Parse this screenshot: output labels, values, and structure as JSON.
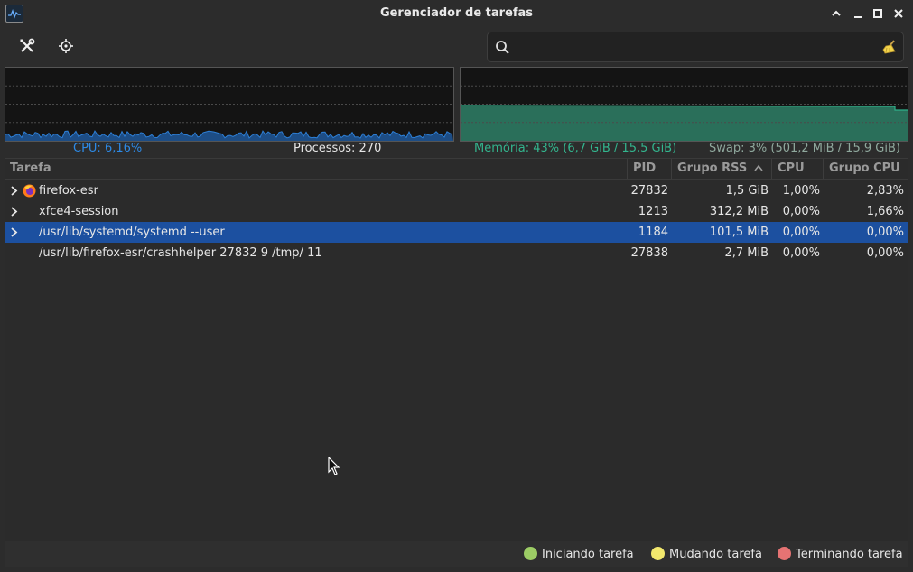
{
  "window": {
    "title": "Gerenciador de tarefas"
  },
  "toolbar": {
    "settings_icon": "tools-icon",
    "target_icon": "crosshair-icon"
  },
  "search": {
    "value": "",
    "placeholder": ""
  },
  "stats": {
    "cpu": "CPU: 6,16%",
    "processes": "Processos: 270",
    "memory": "Memória: 43% (6,7 GiB / 15,5 GiB)",
    "swap": "Swap: 3% (501,2 MiB / 15,9 GiB)"
  },
  "graphs": {
    "cpu_color": "#2d7fd6",
    "mem_color": "#2fb08a",
    "memory_percent": 43
  },
  "table": {
    "columns": [
      "Tarefa",
      "PID",
      "Grupo RSS",
      "CPU",
      "Grupo CPU"
    ],
    "sort_column": "Grupo RSS",
    "rows": [
      {
        "task": "firefox-esr",
        "pid": "27832",
        "rss": "1,5 GiB",
        "cpu": "1,00%",
        "group_cpu": "2,83%",
        "expandable": true,
        "icon": "firefox-icon"
      },
      {
        "task": "xfce4-session",
        "pid": "1213",
        "rss": "312,2 MiB",
        "cpu": "0,00%",
        "group_cpu": "1,66%",
        "expandable": true,
        "icon": ""
      },
      {
        "task": "/usr/lib/systemd/systemd --user",
        "pid": "1184",
        "rss": "101,5 MiB",
        "cpu": "0,00%",
        "group_cpu": "0,00%",
        "expandable": true,
        "selected": true,
        "icon": ""
      },
      {
        "task": "/usr/lib/firefox-esr/crashhelper 27832 9 /tmp/ 11",
        "pid": "27838",
        "rss": "2,7 MiB",
        "cpu": "0,00%",
        "group_cpu": "0,00%",
        "expandable": false,
        "icon": ""
      }
    ]
  },
  "legend": {
    "starting": "Iniciando tarefa",
    "changing": "Mudando tarefa",
    "terminating": "Terminando tarefa",
    "starting_color": "#9ccc65",
    "changing_color": "#f2e86d",
    "terminating_color": "#e57373"
  }
}
